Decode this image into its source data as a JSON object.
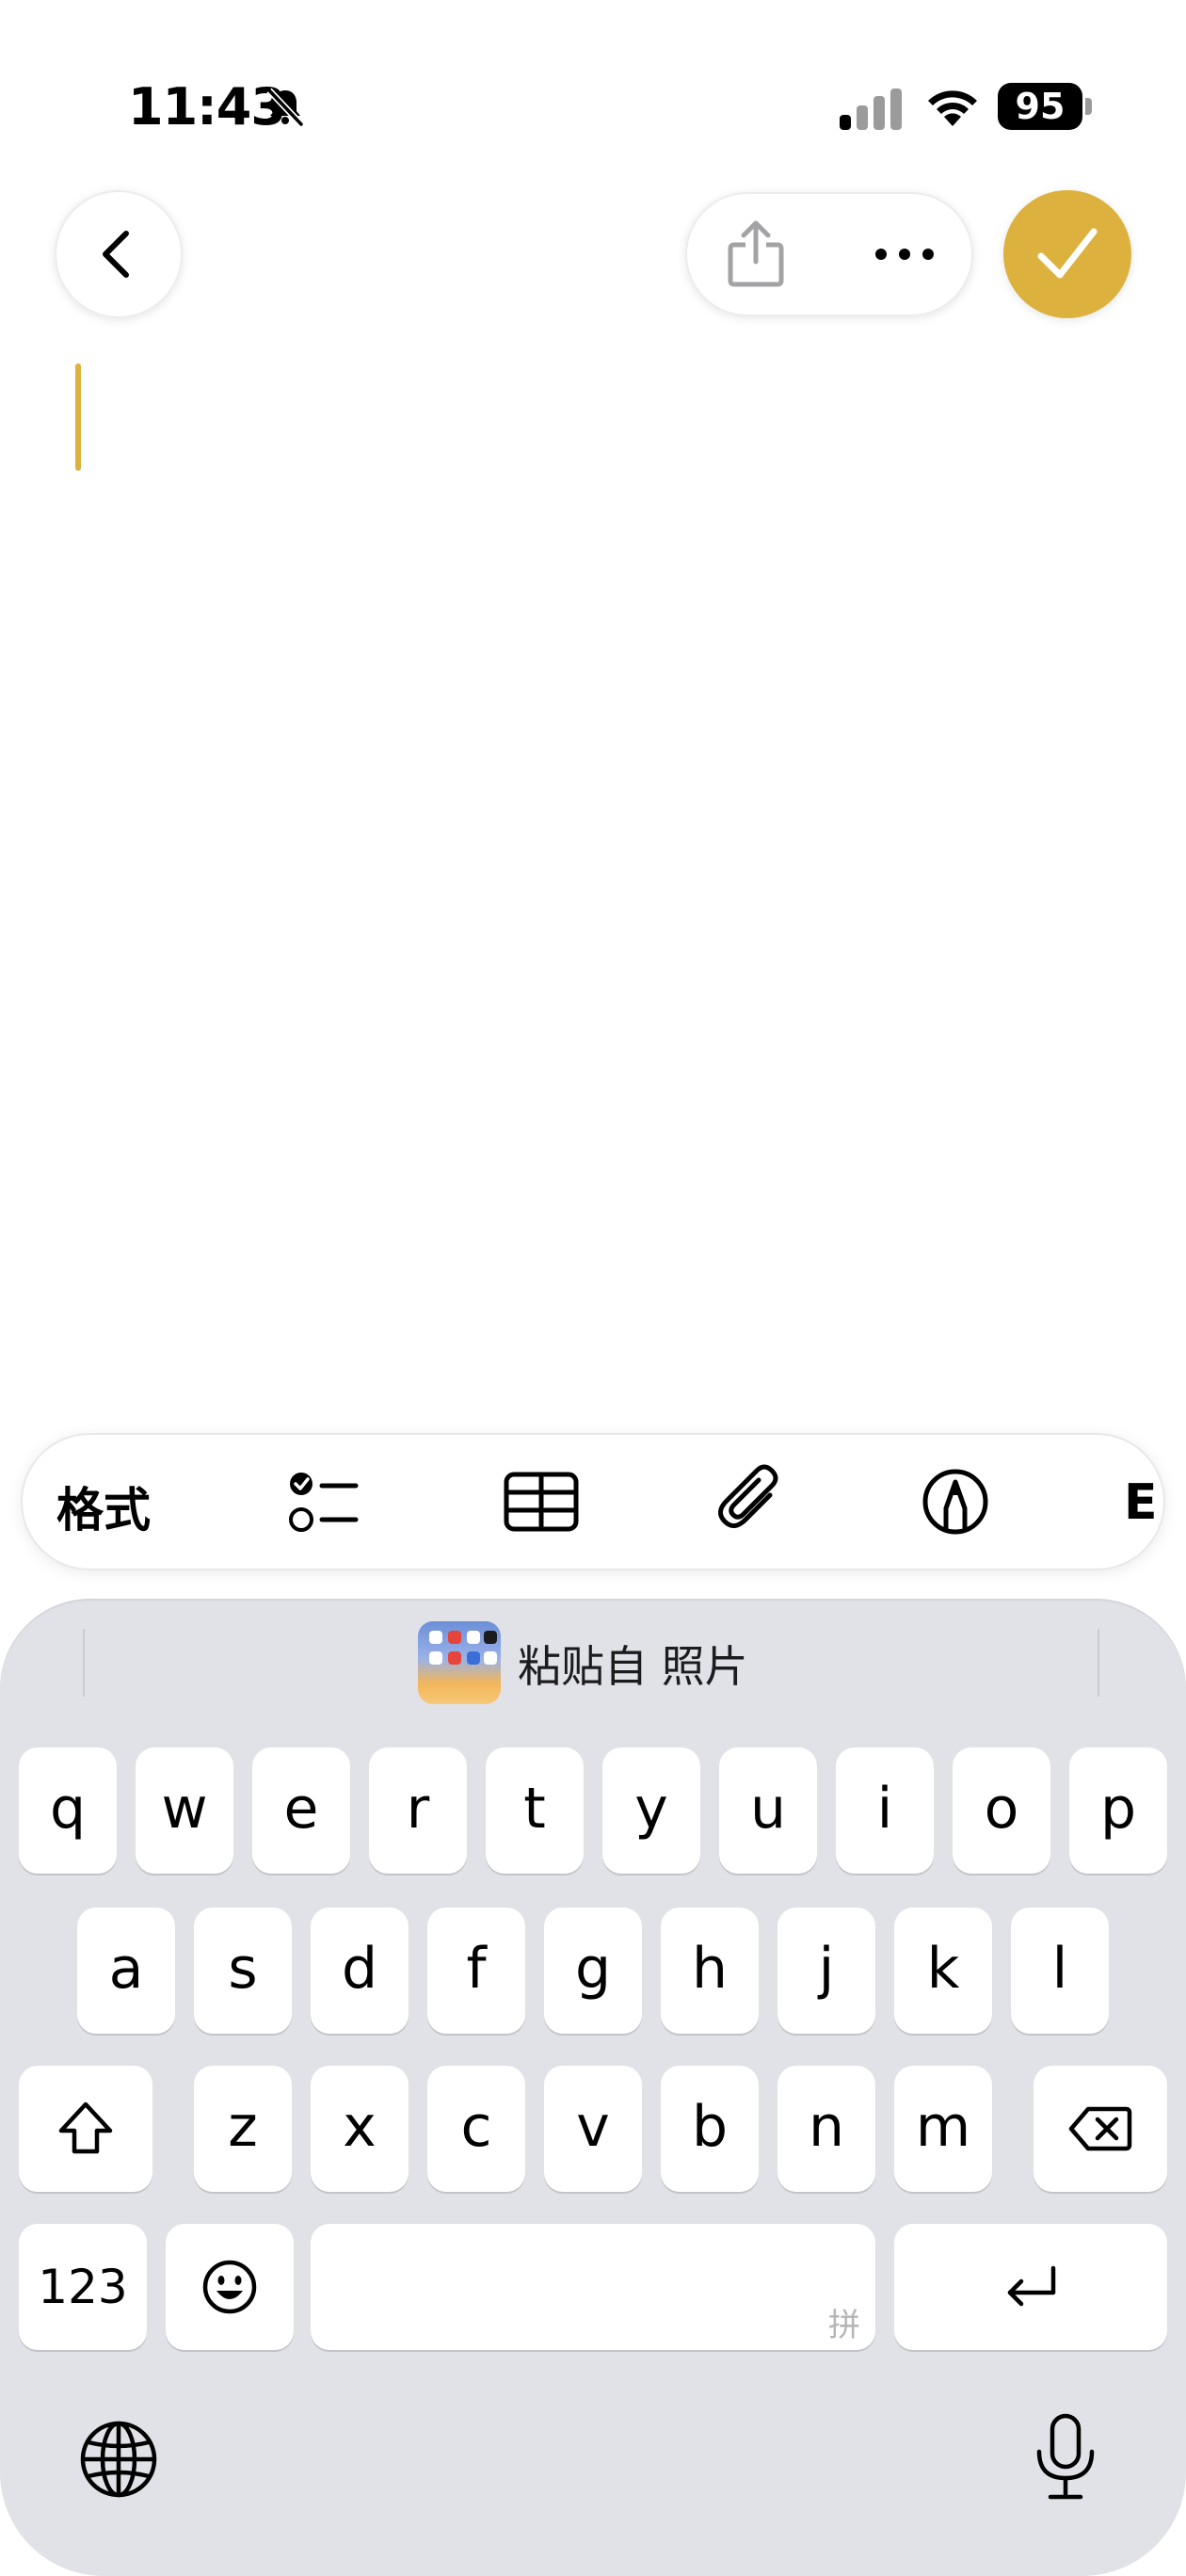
{
  "status_bar": {
    "time": "11:43",
    "battery": "95",
    "icons": [
      "bell-slash-icon",
      "cellular-signal-icon",
      "wifi-icon",
      "battery-icon"
    ]
  },
  "nav": {
    "back_icon": "chevron-left-icon",
    "share_icon": "share-icon",
    "more_icon": "ellipsis-icon",
    "done_icon": "checkmark-icon"
  },
  "colors": {
    "accent": "#dcb13e",
    "keyboard_bg": "#e0e2e7",
    "key_bg": "#ffffff"
  },
  "toolbar": {
    "format_label": "格式",
    "icons": [
      "checklist-icon",
      "table-icon",
      "paperclip-icon",
      "markup-pen-icon"
    ]
  },
  "paste_suggestion": {
    "label": "粘贴自 照片"
  },
  "keyboard": {
    "row1": [
      "q",
      "w",
      "e",
      "r",
      "t",
      "y",
      "u",
      "i",
      "o",
      "p"
    ],
    "row2": [
      "a",
      "s",
      "d",
      "f",
      "g",
      "h",
      "j",
      "k",
      "l"
    ],
    "row3": [
      "z",
      "x",
      "c",
      "v",
      "b",
      "n",
      "m"
    ],
    "numbers_label": "123",
    "space_hint": "拼",
    "icons": [
      "shift-icon",
      "delete-icon",
      "emoji-icon",
      "return-icon",
      "globe-icon",
      "microphone-icon"
    ]
  }
}
